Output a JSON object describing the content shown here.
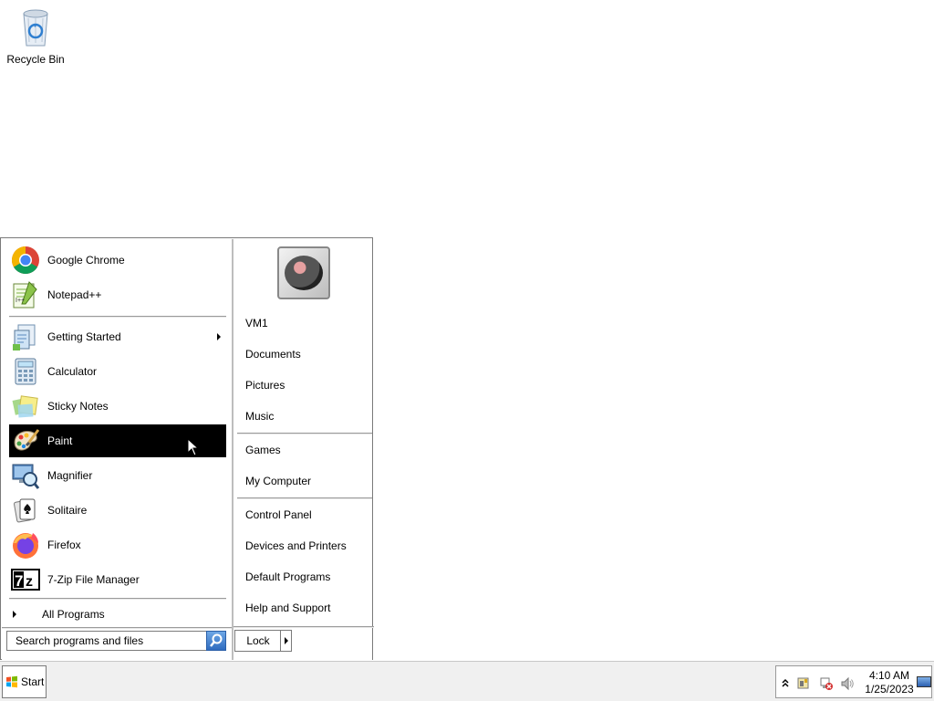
{
  "desktop": {
    "icons": [
      {
        "label": "Recycle Bin",
        "icon": "recycle-bin-icon"
      }
    ]
  },
  "start_menu": {
    "pinned": [
      {
        "label": "Google Chrome",
        "icon": "chrome-icon"
      },
      {
        "label": "Notepad++",
        "icon": "notepad-plus-plus-icon"
      }
    ],
    "recent": [
      {
        "label": "Getting Started",
        "icon": "getting-started-icon",
        "submenu": true
      },
      {
        "label": "Calculator",
        "icon": "calculator-icon"
      },
      {
        "label": "Sticky Notes",
        "icon": "sticky-notes-icon"
      },
      {
        "label": "Paint",
        "icon": "paint-icon",
        "selected": true
      },
      {
        "label": "Magnifier",
        "icon": "magnifier-icon"
      },
      {
        "label": "Solitaire",
        "icon": "solitaire-icon"
      },
      {
        "label": "Firefox",
        "icon": "firefox-icon"
      },
      {
        "label": "7-Zip File Manager",
        "icon": "seven-zip-icon"
      }
    ],
    "all_programs": "All Programs",
    "search_placeholder": "Search programs and files",
    "right_links_group1": [
      "VM1",
      "Documents",
      "Pictures",
      "Music"
    ],
    "right_links_group2": [
      "Games",
      "My Computer"
    ],
    "right_links_group3": [
      "Control Panel",
      "Devices and Printers",
      "Default Programs",
      "Help and Support"
    ],
    "lock_label": "Lock"
  },
  "taskbar": {
    "start_label": "Start",
    "clock_time": "4:10 AM",
    "clock_date": "1/25/2023"
  },
  "colors": {
    "selection": "#000000",
    "taskbar_bg": "#f0f0f0",
    "accent_blue": "#2f6bbf"
  }
}
